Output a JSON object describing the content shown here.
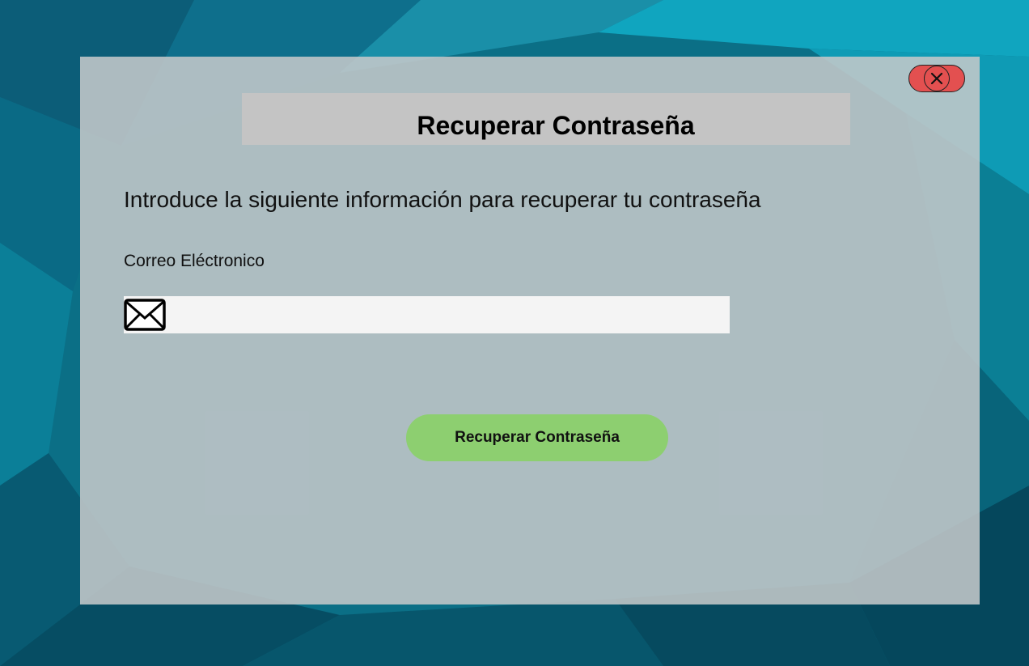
{
  "dialog": {
    "title": "Recuperar Contraseña",
    "intro": "Introduce la siguiente información para recuperar tu contraseña",
    "email_label": "Correo Eléctronico",
    "email_value": "",
    "submit_label": "Recuperar Contraseña"
  },
  "icons": {
    "close": "close-icon",
    "email": "envelope-icon"
  },
  "colors": {
    "close_button": "#e35050",
    "submit_button": "#8dcf70",
    "title_bar": "#c4c4c4",
    "background_teal": "#0a7f96"
  }
}
